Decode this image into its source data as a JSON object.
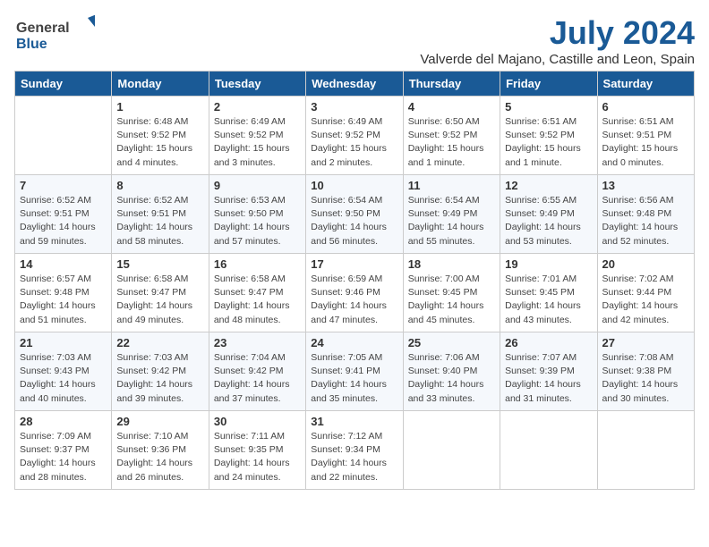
{
  "header": {
    "logo_general": "General",
    "logo_blue": "Blue",
    "title": "July 2024",
    "subtitle": "Valverde del Majano, Castille and Leon, Spain"
  },
  "weekdays": [
    "Sunday",
    "Monday",
    "Tuesday",
    "Wednesday",
    "Thursday",
    "Friday",
    "Saturday"
  ],
  "weeks": [
    [
      {
        "day": "",
        "info": ""
      },
      {
        "day": "1",
        "info": "Sunrise: 6:48 AM\nSunset: 9:52 PM\nDaylight: 15 hours\nand 4 minutes."
      },
      {
        "day": "2",
        "info": "Sunrise: 6:49 AM\nSunset: 9:52 PM\nDaylight: 15 hours\nand 3 minutes."
      },
      {
        "day": "3",
        "info": "Sunrise: 6:49 AM\nSunset: 9:52 PM\nDaylight: 15 hours\nand 2 minutes."
      },
      {
        "day": "4",
        "info": "Sunrise: 6:50 AM\nSunset: 9:52 PM\nDaylight: 15 hours\nand 1 minute."
      },
      {
        "day": "5",
        "info": "Sunrise: 6:51 AM\nSunset: 9:52 PM\nDaylight: 15 hours\nand 1 minute."
      },
      {
        "day": "6",
        "info": "Sunrise: 6:51 AM\nSunset: 9:51 PM\nDaylight: 15 hours\nand 0 minutes."
      }
    ],
    [
      {
        "day": "7",
        "info": "Sunrise: 6:52 AM\nSunset: 9:51 PM\nDaylight: 14 hours\nand 59 minutes."
      },
      {
        "day": "8",
        "info": "Sunrise: 6:52 AM\nSunset: 9:51 PM\nDaylight: 14 hours\nand 58 minutes."
      },
      {
        "day": "9",
        "info": "Sunrise: 6:53 AM\nSunset: 9:50 PM\nDaylight: 14 hours\nand 57 minutes."
      },
      {
        "day": "10",
        "info": "Sunrise: 6:54 AM\nSunset: 9:50 PM\nDaylight: 14 hours\nand 56 minutes."
      },
      {
        "day": "11",
        "info": "Sunrise: 6:54 AM\nSunset: 9:49 PM\nDaylight: 14 hours\nand 55 minutes."
      },
      {
        "day": "12",
        "info": "Sunrise: 6:55 AM\nSunset: 9:49 PM\nDaylight: 14 hours\nand 53 minutes."
      },
      {
        "day": "13",
        "info": "Sunrise: 6:56 AM\nSunset: 9:48 PM\nDaylight: 14 hours\nand 52 minutes."
      }
    ],
    [
      {
        "day": "14",
        "info": "Sunrise: 6:57 AM\nSunset: 9:48 PM\nDaylight: 14 hours\nand 51 minutes."
      },
      {
        "day": "15",
        "info": "Sunrise: 6:58 AM\nSunset: 9:47 PM\nDaylight: 14 hours\nand 49 minutes."
      },
      {
        "day": "16",
        "info": "Sunrise: 6:58 AM\nSunset: 9:47 PM\nDaylight: 14 hours\nand 48 minutes."
      },
      {
        "day": "17",
        "info": "Sunrise: 6:59 AM\nSunset: 9:46 PM\nDaylight: 14 hours\nand 47 minutes."
      },
      {
        "day": "18",
        "info": "Sunrise: 7:00 AM\nSunset: 9:45 PM\nDaylight: 14 hours\nand 45 minutes."
      },
      {
        "day": "19",
        "info": "Sunrise: 7:01 AM\nSunset: 9:45 PM\nDaylight: 14 hours\nand 43 minutes."
      },
      {
        "day": "20",
        "info": "Sunrise: 7:02 AM\nSunset: 9:44 PM\nDaylight: 14 hours\nand 42 minutes."
      }
    ],
    [
      {
        "day": "21",
        "info": "Sunrise: 7:03 AM\nSunset: 9:43 PM\nDaylight: 14 hours\nand 40 minutes."
      },
      {
        "day": "22",
        "info": "Sunrise: 7:03 AM\nSunset: 9:42 PM\nDaylight: 14 hours\nand 39 minutes."
      },
      {
        "day": "23",
        "info": "Sunrise: 7:04 AM\nSunset: 9:42 PM\nDaylight: 14 hours\nand 37 minutes."
      },
      {
        "day": "24",
        "info": "Sunrise: 7:05 AM\nSunset: 9:41 PM\nDaylight: 14 hours\nand 35 minutes."
      },
      {
        "day": "25",
        "info": "Sunrise: 7:06 AM\nSunset: 9:40 PM\nDaylight: 14 hours\nand 33 minutes."
      },
      {
        "day": "26",
        "info": "Sunrise: 7:07 AM\nSunset: 9:39 PM\nDaylight: 14 hours\nand 31 minutes."
      },
      {
        "day": "27",
        "info": "Sunrise: 7:08 AM\nSunset: 9:38 PM\nDaylight: 14 hours\nand 30 minutes."
      }
    ],
    [
      {
        "day": "28",
        "info": "Sunrise: 7:09 AM\nSunset: 9:37 PM\nDaylight: 14 hours\nand 28 minutes."
      },
      {
        "day": "29",
        "info": "Sunrise: 7:10 AM\nSunset: 9:36 PM\nDaylight: 14 hours\nand 26 minutes."
      },
      {
        "day": "30",
        "info": "Sunrise: 7:11 AM\nSunset: 9:35 PM\nDaylight: 14 hours\nand 24 minutes."
      },
      {
        "day": "31",
        "info": "Sunrise: 7:12 AM\nSunset: 9:34 PM\nDaylight: 14 hours\nand 22 minutes."
      },
      {
        "day": "",
        "info": ""
      },
      {
        "day": "",
        "info": ""
      },
      {
        "day": "",
        "info": ""
      }
    ]
  ]
}
